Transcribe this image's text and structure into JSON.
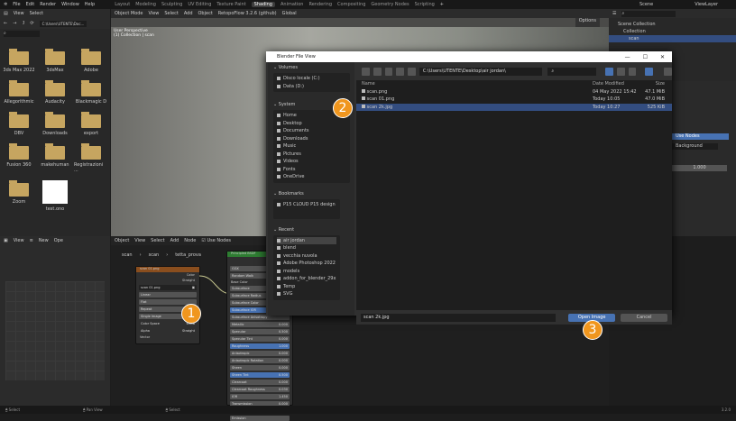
{
  "menu": [
    "File",
    "Edit",
    "Render",
    "Window",
    "Help"
  ],
  "workspaces": [
    "Layout",
    "Modeling",
    "Sculpting",
    "UV Editing",
    "Texture Paint",
    "Shading",
    "Animation",
    "Rendering",
    "Compositing",
    "Geometry Nodes",
    "Scripting"
  ],
  "active_workspace": "Shading",
  "scene": "Scene",
  "view_layer": "ViewLayer",
  "filebrowser": {
    "view": "View",
    "select": "Select",
    "path": "C:\\Users\\UTENTE\\Doc...",
    "items": [
      "3ds Max 2022",
      "3dsMax",
      "Adobe",
      "Allegorithmic",
      "Audacity",
      "Blackmagic D",
      "DBV",
      "Downloads",
      "export",
      "Fusion 360",
      "makehuman",
      "Registrazioni ...",
      "Zoom"
    ],
    "image_item": "test.ono"
  },
  "viewport": {
    "mode": "Object Mode",
    "view": "View",
    "select": "Select",
    "add": "Add",
    "object": "Object",
    "addon": "RetopoFlow 3.2.6 (github)",
    "orientation": "Global",
    "label1": "User Perspective",
    "label2": "(1) Collection | scan",
    "options": "Options"
  },
  "outliner": {
    "root": "Scene Collection",
    "collection": "Collection",
    "object": "scan"
  },
  "properties": {
    "use_nodes": "Use Nodes",
    "surface": "Background",
    "strength": "1.000"
  },
  "uv": {
    "view": "View",
    "new": "New",
    "open": "Ope"
  },
  "node_editor": {
    "object": "Object",
    "view": "View",
    "select": "Select",
    "add": "Add",
    "node": "Node",
    "use_nodes": "Use Nodes",
    "breadcrumb": [
      "scan",
      "scan",
      "tetta_prova"
    ],
    "image_node": {
      "title": "scan 01.png",
      "color": "Color",
      "alpha": "Straight",
      "image": "scan 01.png",
      "rows": [
        "Linear",
        "Flat",
        "Repeat",
        "Single Image"
      ],
      "color_space_label": "Color Space",
      "color_space": "sRGB",
      "alpha_label": "Alpha",
      "vector": "Vector"
    },
    "bsdf": {
      "title": "Principled BSDF",
      "top": [
        "GGX",
        "Random Walk"
      ],
      "base_color": "Base Color",
      "rows": [
        [
          "Subsurface",
          ""
        ],
        [
          "Subsurface Radius",
          ""
        ],
        [
          "Subsurface Color",
          ""
        ],
        [
          "Subsurface IOR",
          ""
        ],
        [
          "Subsurface Anisotropy",
          ""
        ],
        [
          "Metallic",
          "0.000"
        ],
        [
          "Specular",
          "0.500"
        ],
        [
          "Specular Tint",
          "0.000"
        ],
        [
          "Roughness",
          "1.000"
        ],
        [
          "Anisotropic",
          "0.000"
        ],
        [
          "Anisotropic Rotation",
          "0.000"
        ],
        [
          "Sheen",
          "0.000"
        ],
        [
          "Sheen Tint",
          "0.500"
        ],
        [
          "Clearcoat",
          "0.000"
        ],
        [
          "Clearcoat Roughness",
          "0.030"
        ],
        [
          "IOR",
          "1.450"
        ],
        [
          "Transmission",
          "0.000"
        ],
        [
          "Transmission Roughness",
          "0.000"
        ],
        [
          "Emission",
          ""
        ]
      ]
    }
  },
  "dialog": {
    "title": "Blender File View",
    "path": "C:\\Users\\UTENTE\\Desktop\\air jordan\\",
    "volumes_label": "Volumes",
    "volumes": [
      "Disco locale (C:)",
      "Data (D:)"
    ],
    "system_label": "System",
    "system": [
      "Home",
      "Desktop",
      "Documents",
      "Downloads",
      "Music",
      "Pictures",
      "Videos",
      "Fonts",
      "OneDrive"
    ],
    "bookmarks_label": "Bookmarks",
    "bookmarks": [
      "P15 CLOUD P15 design"
    ],
    "recent_label": "Recent",
    "recent": [
      "air jordan",
      "blend",
      "vecchia nuvola",
      "Adobe Photoshop 2022",
      "models",
      "addon_for_blender_29x",
      "Temp",
      "SVG"
    ],
    "columns": [
      "Name",
      "Date Modified",
      "Size"
    ],
    "files": [
      {
        "name": "scan.png",
        "date": "04 May 2022 15:42",
        "size": "47.1 MiB"
      },
      {
        "name": "scan 01.png",
        "date": "Today 10:05",
        "size": "47.0 MiB"
      },
      {
        "name": "scan 2k.jpg",
        "date": "Today 10:27",
        "size": "525 KiB",
        "selected": true
      }
    ],
    "filename": "scan 2k.jpg",
    "open": "Open Image",
    "cancel": "Cancel"
  },
  "steps": [
    "1",
    "2",
    "3"
  ],
  "status": [
    "Select",
    "Pan View",
    "Select"
  ],
  "version": "3.2.0",
  "colors": {
    "accent": "#4772b3",
    "selection": "#334d80",
    "badge": "#f0961e",
    "folder": "#c6a560"
  }
}
